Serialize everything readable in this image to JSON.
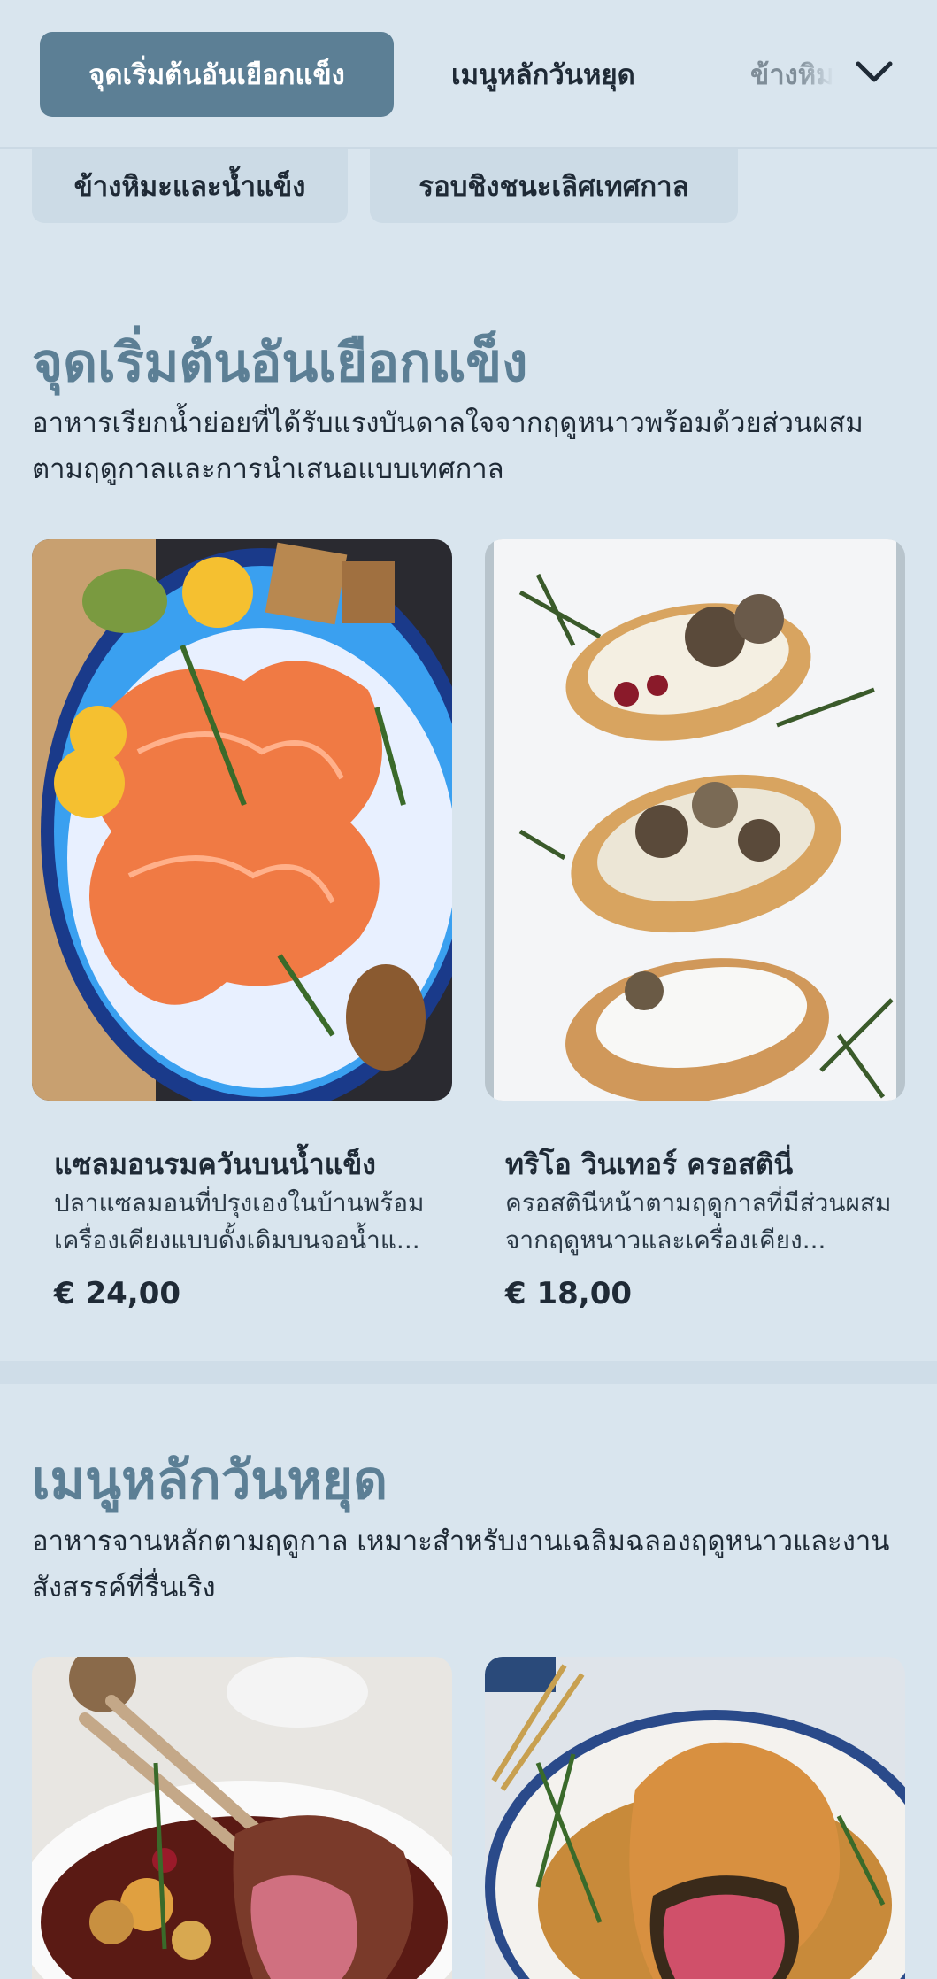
{
  "nav": {
    "tabs": [
      {
        "label": "จุดเริ่มต้นอันเยือกแข็ง",
        "active": true
      },
      {
        "label": "เมนูหลักวันหยุด",
        "active": false
      },
      {
        "label": "ข้างหิมะ",
        "active": false
      }
    ],
    "chips": [
      {
        "label": "ข้างหิมะและน้ำแข็ง"
      },
      {
        "label": "รอบชิงชนะเลิศเทศกาล"
      }
    ],
    "expand_icon": "chevron-down-icon"
  },
  "sections": [
    {
      "title": "จุดเริ่มต้นอันเยือกแข็ง",
      "description": "อาหารเรียกน้ำย่อยที่ได้รับแรงบันดาลใจจากฤดูหนาวพร้อมด้วยส่วนผสมตามฤดูกาลและการนำเสนอแบบเทศกาล",
      "items": [
        {
          "name": "แซลมอนรมควันบนน้ำแข็ง",
          "description": "ปลาแซลมอนที่ปรุงเองในบ้านพร้อมเครื่องเคียงแบบดั้งเดิมบนจอน้ำแ...",
          "price": "€ 24,00"
        },
        {
          "name": "ทริโอ วินเทอร์ ครอสตินี่",
          "description": "ครอสตินีหน้าตามฤดูกาลที่มีส่วนผสมจากฤดูหนาวและเครื่องเคียง...",
          "price": "€ 18,00"
        }
      ]
    },
    {
      "title": "เมนูหลักวันหยุด",
      "description": "อาหารจานหลักตามฤดูกาล เหมาะสำหรับงานเฉลิมฉลองฤดูหนาวและงานสังสรรค์ที่รื่นเริง",
      "items": [
        {
          "name": "",
          "description": "",
          "price": ""
        },
        {
          "name": "",
          "description": "",
          "price": ""
        }
      ]
    }
  ],
  "colors": {
    "background": "#d9e5ee",
    "accent": "#5c7f95",
    "chip": "#ccdbe6",
    "text": "#1f2a36"
  }
}
